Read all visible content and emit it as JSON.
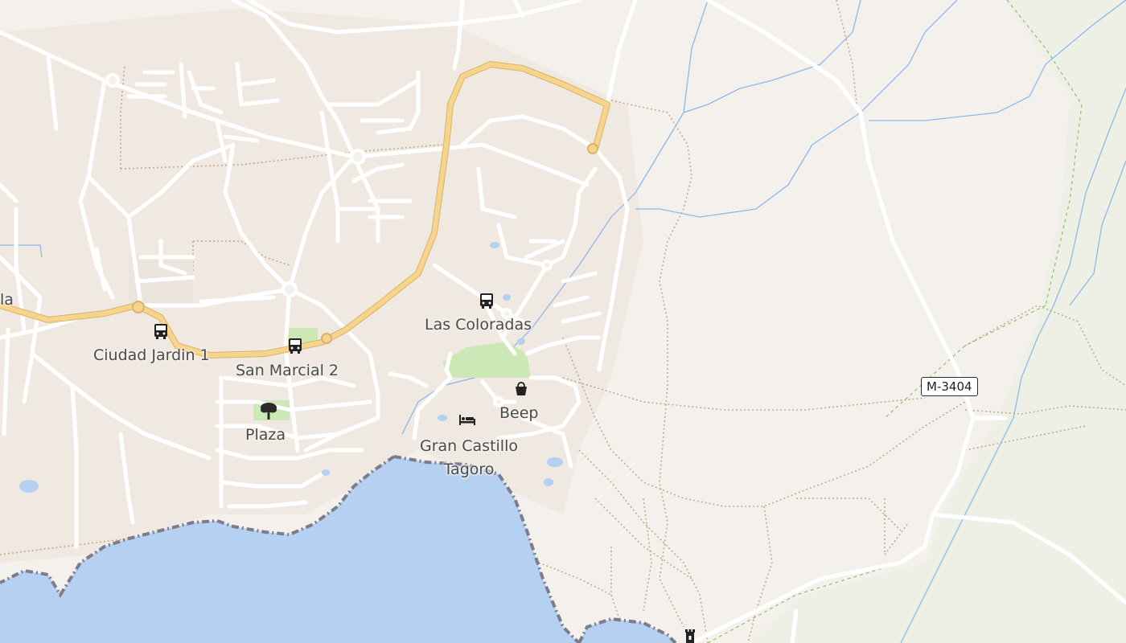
{
  "map": {
    "colors": {
      "land": "#f4f1ec",
      "sea": "#b5d0f0",
      "road_major": "#f7d48b",
      "road_minor": "#ffffff",
      "park": "#cde8b7",
      "stream": "#8db8ec",
      "footpath": "#c7a98a",
      "boundary": "#7d7b8c"
    },
    "labels": {
      "partial_west": "la",
      "ciudad_jardin": "Ciudad Jardin 1",
      "san_marcial": "San Marcial 2",
      "las_coloradas": "Las Coloradas",
      "beep": "Beep",
      "gran_castillo": "Gran Castillo Tagoro",
      "plaza": "Plaza"
    },
    "road_ref": "M-3404",
    "icons": [
      "bus-stop-icon",
      "bus-stop-icon",
      "bus-stop-icon",
      "shop-bag-icon",
      "hotel-bed-icon",
      "park-tree-icon",
      "tower-icon"
    ]
  }
}
